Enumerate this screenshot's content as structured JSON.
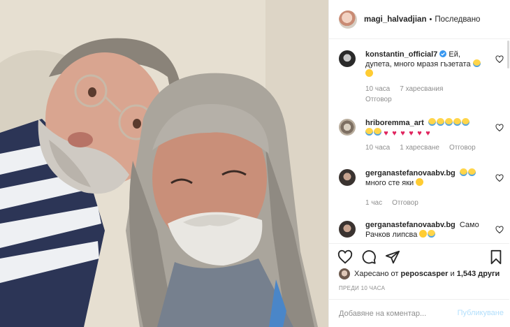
{
  "post": {
    "owner_username": "magi_halvadjian",
    "separator": "•",
    "follow_status": "Последвано"
  },
  "comments": [
    {
      "username": "konstantin_official7",
      "text": "Ей, дупета, много мразя гъзетата",
      "time": "10 часа",
      "likes": "7 харесвания",
      "reply": "Отговор"
    },
    {
      "username": "hriboremma_art",
      "text": "",
      "time": "10 часа",
      "likes": "1 харесване",
      "reply": "Отговор"
    },
    {
      "username": "gerganastefanovaabv.bg",
      "text": "много сте яки",
      "time": "1 час",
      "reply": "Отговор"
    },
    {
      "username": "gerganastefanovaabv.bg",
      "text": "Само Рачков липсва"
    }
  ],
  "liked_by": {
    "prefix": "Харесано от",
    "user": "peposcasper",
    "conj": "и",
    "others": "1,543 други"
  },
  "posted_ago": "ПРЕДИ 10 ЧАСА",
  "add_comment": {
    "placeholder": "Добавяне на коментар...",
    "publish_label": "Публикуване"
  },
  "icons": {
    "like": "heart-outline-icon",
    "comment": "speech-bubble-icon",
    "share": "paper-plane-icon",
    "save": "bookmark-icon",
    "verified": "verified-badge-icon"
  },
  "colors": {
    "text": "#262626",
    "muted": "#8e8e8e",
    "border": "#efefef",
    "verified": "#3897f0",
    "publish_disabled": "#b2dffc"
  }
}
